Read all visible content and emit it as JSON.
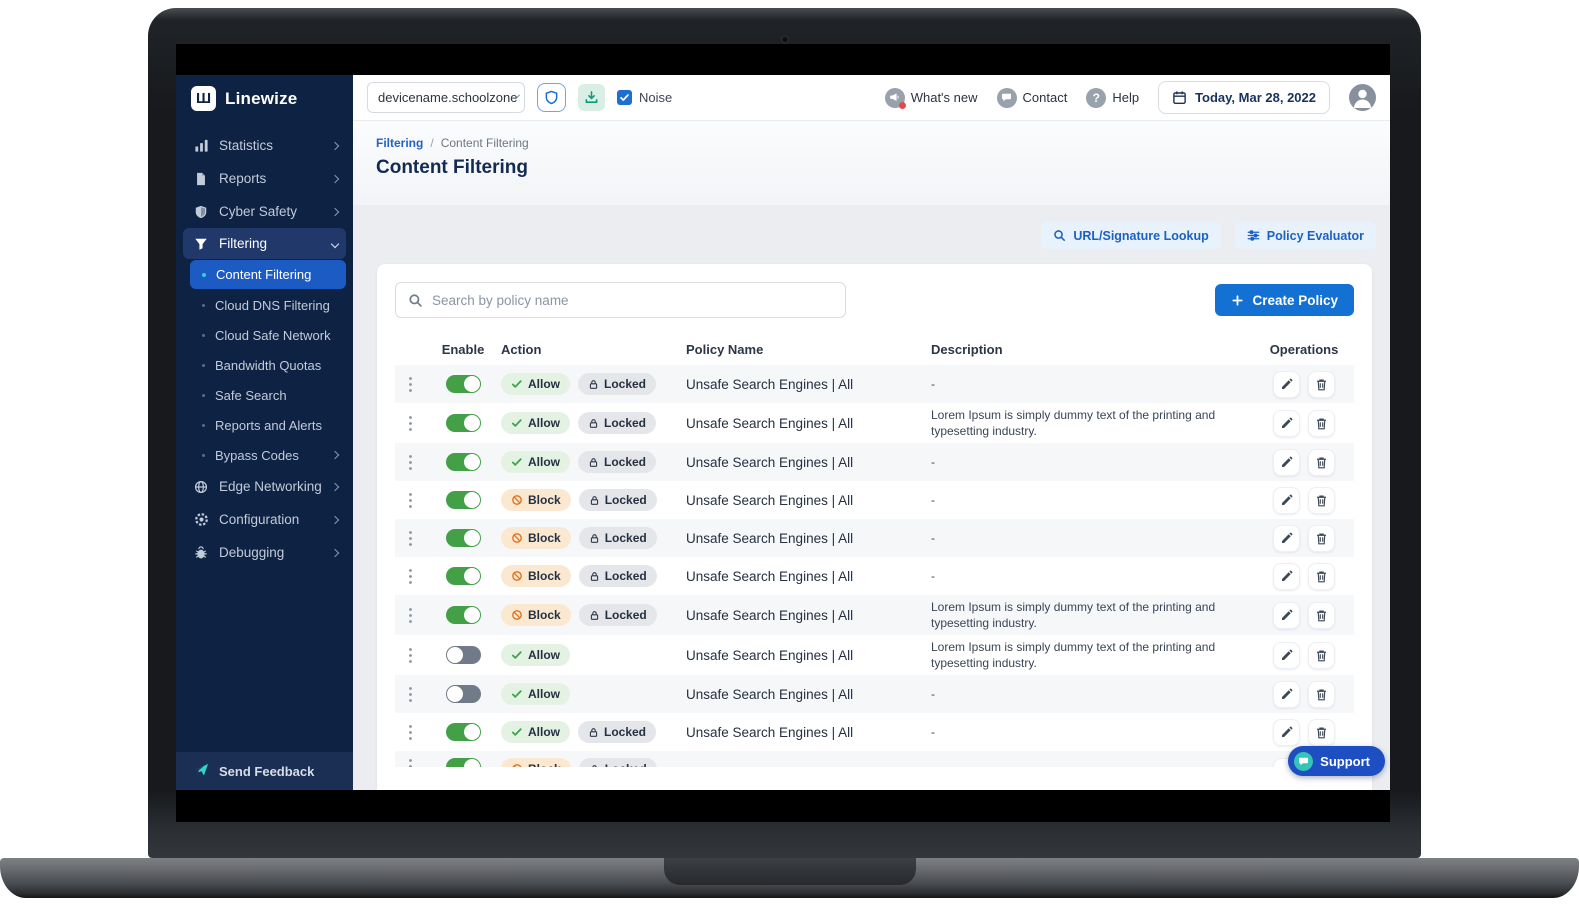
{
  "brand": {
    "name": "Linewize",
    "mark_glyph": "Ш"
  },
  "topbar": {
    "device_selector": "devicename.schoolzone",
    "noise_label": "Noise",
    "whats_new_label": "What's new",
    "contact_label": "Contact",
    "help_label": "Help",
    "help_glyph": "?",
    "date_label": "Today, Mar 28, 2022"
  },
  "sidebar": {
    "items": [
      {
        "label": "Statistics"
      },
      {
        "label": "Reports"
      },
      {
        "label": "Cyber Safety"
      },
      {
        "label": "Filtering",
        "active": true
      },
      {
        "label": "Content Filtering",
        "active_sub": true
      },
      {
        "label": "Cloud DNS Filtering"
      },
      {
        "label": "Cloud Safe Network"
      },
      {
        "label": "Bandwidth Quotas"
      },
      {
        "label": "Safe Search"
      },
      {
        "label": "Reports and Alerts"
      },
      {
        "label": "Bypass Codes"
      },
      {
        "label": "Edge Networking"
      },
      {
        "label": "Configuration"
      },
      {
        "label": "Debugging"
      }
    ],
    "feedback_label": "Send Feedback"
  },
  "breadcrumb": {
    "parent": "Filtering",
    "separator": "/",
    "current": "Content Filtering"
  },
  "page": {
    "title": "Content Filtering"
  },
  "actions": {
    "lookup_label": "URL/Signature Lookup",
    "evaluator_label": "Policy Evaluator",
    "create_label": "Create Policy",
    "search_placeholder": "Search by policy name"
  },
  "table": {
    "headers": {
      "enable": "Enable",
      "action": "Action",
      "name": "Policy Name",
      "description": "Description",
      "operations": "Operations"
    },
    "locked_label": "Locked",
    "rows": [
      {
        "enabled": true,
        "action": "Allow",
        "locked": true,
        "name": "Unsafe Search Engines | All",
        "description": "-"
      },
      {
        "enabled": true,
        "action": "Allow",
        "locked": true,
        "name": "Unsafe Search Engines | All",
        "description": "Lorem Ipsum is simply dummy text of the printing and typesetting industry."
      },
      {
        "enabled": true,
        "action": "Allow",
        "locked": true,
        "name": "Unsafe Search Engines | All",
        "description": "-"
      },
      {
        "enabled": true,
        "action": "Block",
        "locked": true,
        "name": "Unsafe Search Engines | All",
        "description": "-"
      },
      {
        "enabled": true,
        "action": "Block",
        "locked": true,
        "name": "Unsafe Search Engines | All",
        "description": "-"
      },
      {
        "enabled": true,
        "action": "Block",
        "locked": true,
        "name": "Unsafe Search Engines | All",
        "description": "-"
      },
      {
        "enabled": true,
        "action": "Block",
        "locked": true,
        "name": "Unsafe Search Engines | All",
        "description": "Lorem Ipsum is simply dummy text of the printing and typesetting industry."
      },
      {
        "enabled": false,
        "action": "Allow",
        "locked": false,
        "name": "Unsafe Search Engines | All",
        "description": "Lorem Ipsum is simply dummy text of the printing and typesetting industry."
      },
      {
        "enabled": false,
        "action": "Allow",
        "locked": false,
        "name": "Unsafe Search Engines | All",
        "description": "-"
      },
      {
        "enabled": true,
        "action": "Allow",
        "locked": true,
        "name": "Unsafe Search Engines | All",
        "description": "-"
      },
      {
        "enabled": true,
        "action": "Block",
        "locked": true,
        "name": "",
        "description": "",
        "partial": true
      }
    ]
  },
  "support": {
    "label": "Support"
  },
  "colors": {
    "sidebar_navy": "#0E2243",
    "active_sub_blue": "#1D5BC4",
    "teal_accent": "#2FD5C8",
    "primary_blue": "#1271D3",
    "link_blue": "#2563C2",
    "toggle_green": "#43A047",
    "allow_bg": "#E3F2E3",
    "block_bg": "#FBE8D1",
    "block_orange": "#E0711F",
    "locked_bg": "#E4E6EA",
    "support_blue": "#1D4EC2",
    "row_stripe": "#F6F7F9"
  }
}
